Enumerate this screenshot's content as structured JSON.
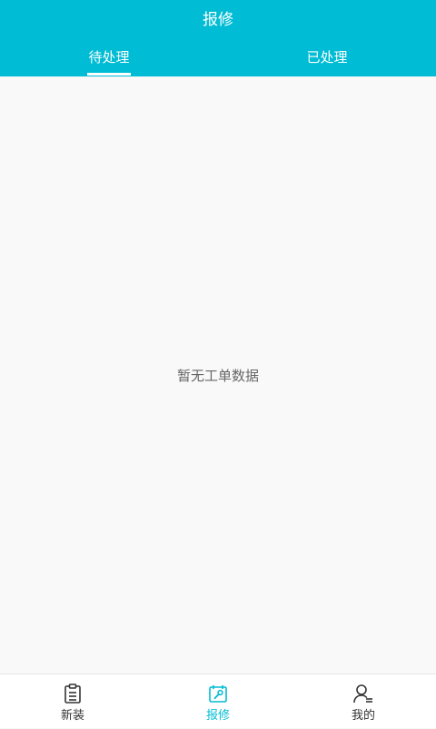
{
  "header": {
    "title": "报修"
  },
  "tabs": [
    {
      "label": "待处理",
      "active": true
    },
    {
      "label": "已处理",
      "active": false
    }
  ],
  "main": {
    "empty_text": "暂无工单数据"
  },
  "bottom_nav": {
    "items": [
      {
        "label": "新装",
        "icon": "clipboard-icon",
        "active": false
      },
      {
        "label": "报修",
        "icon": "wrench-icon",
        "active": true
      },
      {
        "label": "我的",
        "icon": "user-icon",
        "active": false
      }
    ]
  },
  "colors": {
    "accent": "#00bcd4",
    "background": "#f9f9f9",
    "text_primary": "#333333",
    "text_secondary": "#666666"
  }
}
